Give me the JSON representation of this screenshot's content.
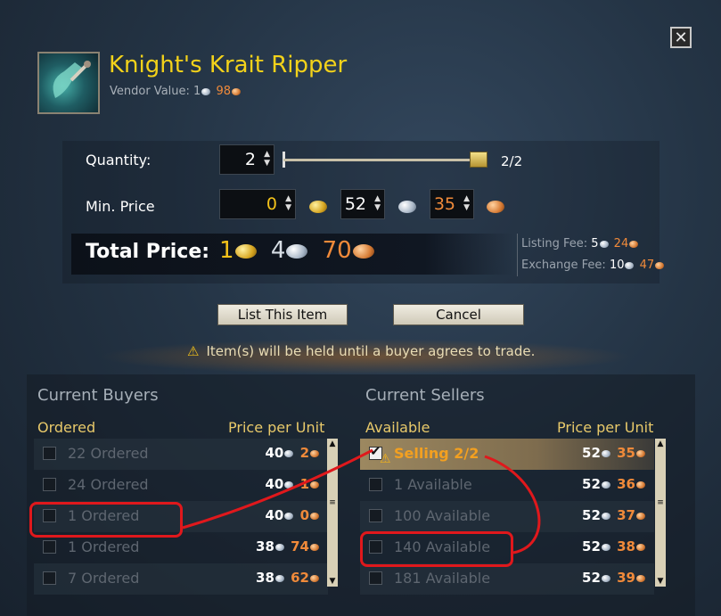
{
  "close_label": "✕",
  "item": {
    "name": "Knight's Krait Ripper",
    "vendor_label": "Vendor Value:",
    "vendor_silver": "1",
    "vendor_copper": "98"
  },
  "quantity": {
    "label": "Quantity:",
    "value": "2",
    "max_text": "2/2"
  },
  "min_price": {
    "label": "Min. Price",
    "gold": "0",
    "silver": "52",
    "copper": "35"
  },
  "total": {
    "label": "Total Price:",
    "gold": "1",
    "silver": "4",
    "copper": "70"
  },
  "fees": {
    "listing_label": "Listing Fee:",
    "listing_silver": "5",
    "listing_copper": "24",
    "exchange_label": "Exchange Fee:",
    "exchange_silver": "10",
    "exchange_copper": "47"
  },
  "buttons": {
    "list": "List This Item",
    "cancel": "Cancel"
  },
  "warning": "Item(s) will be held until a buyer agrees to trade.",
  "buyers": {
    "title": "Current Buyers",
    "col_left": "Ordered",
    "col_right": "Price per Unit",
    "rows": [
      {
        "name": "22 Ordered",
        "silver": "40",
        "copper": "2"
      },
      {
        "name": "24 Ordered",
        "silver": "40",
        "copper": "1"
      },
      {
        "name": "1 Ordered",
        "silver": "40",
        "copper": "0"
      },
      {
        "name": "1 Ordered",
        "silver": "38",
        "copper": "74"
      },
      {
        "name": "7 Ordered",
        "silver": "38",
        "copper": "62"
      }
    ]
  },
  "sellers": {
    "title": "Current Sellers",
    "col_left": "Available",
    "col_right": "Price per Unit",
    "rows": [
      {
        "name": "Selling 2/2",
        "silver": "52",
        "copper": "35"
      },
      {
        "name": "1 Available",
        "silver": "52",
        "copper": "36"
      },
      {
        "name": "100 Available",
        "silver": "52",
        "copper": "37"
      },
      {
        "name": "140 Available",
        "silver": "52",
        "copper": "38"
      },
      {
        "name": "181 Available",
        "silver": "52",
        "copper": "39"
      }
    ]
  },
  "colors": {
    "title": "#f3d21a",
    "copper_text": "#f08a3a",
    "gold_text": "#f3c21a",
    "header_gold": "#e8c96a",
    "annotation_red": "#e0181c"
  }
}
